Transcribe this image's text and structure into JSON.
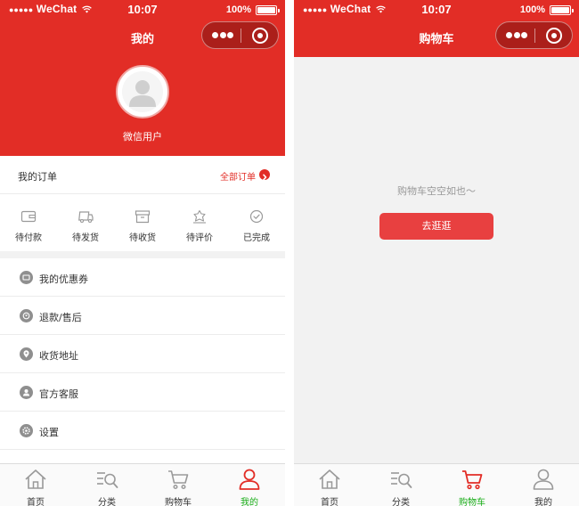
{
  "status_bar": {
    "carrier": "WeChat",
    "time": "10:07",
    "battery": "100%"
  },
  "profile": {
    "nav_title": "我的",
    "username": "微信用户",
    "orders": {
      "title": "我的订单",
      "all_link": "全部订单",
      "statuses": [
        {
          "label": "待付款",
          "icon": "wallet-icon"
        },
        {
          "label": "待发货",
          "icon": "truck-icon"
        },
        {
          "label": "待收货",
          "icon": "box-icon"
        },
        {
          "label": "待评价",
          "icon": "review-icon"
        },
        {
          "label": "已完成",
          "icon": "check-circle-icon"
        }
      ]
    },
    "menu": [
      {
        "label": "我的优惠券",
        "icon": "coupon-icon"
      },
      {
        "label": "退款/售后",
        "icon": "refund-icon"
      },
      {
        "label": "收货地址",
        "icon": "location-icon"
      },
      {
        "label": "官方客服",
        "icon": "service-icon"
      },
      {
        "label": "设置",
        "icon": "settings-icon"
      }
    ]
  },
  "cart": {
    "nav_title": "购物车",
    "empty_text": "购物车空空如也～",
    "go_button": "去逛逛"
  },
  "tabbar": {
    "items": [
      {
        "label": "首页",
        "icon": "home-icon"
      },
      {
        "label": "分类",
        "icon": "category-icon"
      },
      {
        "label": "购物车",
        "icon": "cart-icon"
      },
      {
        "label": "我的",
        "icon": "user-icon"
      }
    ]
  },
  "colors": {
    "brand": "#e22d26",
    "tab_active": "#1aad19",
    "background": "#f2f2f2"
  }
}
